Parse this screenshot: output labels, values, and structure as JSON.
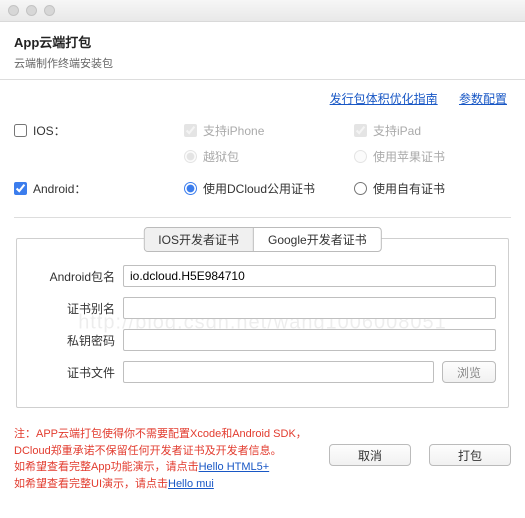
{
  "header": {
    "title": "App云端打包",
    "subtitle": "云端制作终端安装包"
  },
  "links": {
    "guide": "发行包体积优化指南",
    "params": "参数配置"
  },
  "platform": {
    "ios": {
      "label": "IOS：",
      "checked": false,
      "supportIphone": "支持iPhone",
      "supportIpad": "支持iPad",
      "jailbreak": "越狱包",
      "appleCert": "使用苹果证书"
    },
    "android": {
      "label": "Android：",
      "checked": true,
      "dcloudCert": "使用DCloud公用证书",
      "ownCert": "使用自有证书"
    }
  },
  "seg": {
    "ios": "IOS开发者证书",
    "google": "Google开发者证书"
  },
  "form": {
    "pkgLabel": "Android包名",
    "pkgValue": "io.dcloud.H5E984710",
    "aliasLabel": "证书别名",
    "aliasValue": "",
    "pwdLabel": "私钥密码",
    "pwdValue": "",
    "fileLabel": "证书文件",
    "fileValue": "",
    "browse": "浏览"
  },
  "note": {
    "prefix": "注：",
    "l1": "APP云端打包使得你不需要配置Xcode和Android SDK，",
    "l2": "DCloud郑重承诺不保留任何开发者证书及开发者信息。",
    "l3a": "如希望查看完整App功能演示，请点击",
    "link1": "Hello HTML5+",
    "l4a": "如希望查看完整UI演示，请点击",
    "link2": "Hello mui"
  },
  "footer": {
    "cancel": "取消",
    "pack": "打包"
  },
  "watermark": "http://blog.csdn.net/wang1006008051"
}
